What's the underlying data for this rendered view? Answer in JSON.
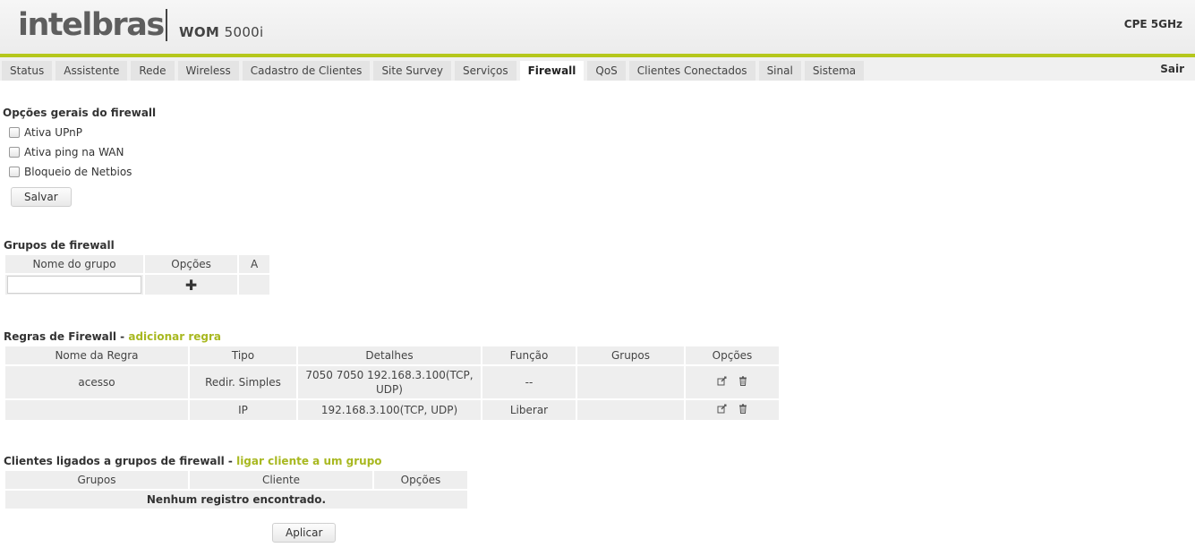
{
  "header": {
    "logo": "intelbras",
    "product_bold": "WOM",
    "product_suffix": "5000i",
    "device_type": "CPE 5GHz"
  },
  "nav": {
    "tabs": [
      "Status",
      "Assistente",
      "Rede",
      "Wireless",
      "Cadastro de Clientes",
      "Site Survey",
      "Serviços",
      "Firewall",
      "QoS",
      "Clientes Conectados",
      "Sinal",
      "Sistema"
    ],
    "active": "Firewall",
    "logout": "Sair"
  },
  "general": {
    "title": "Opções gerais do firewall",
    "options": [
      "Ativa UPnP",
      "Ativa ping na WAN",
      "Bloqueio de Netbios"
    ],
    "save_label": "Salvar"
  },
  "groups": {
    "title": "Grupos de firewall",
    "headers": [
      "Nome do grupo",
      "Opções",
      "A"
    ],
    "input_value": ""
  },
  "rules": {
    "title": "Regras de Firewall",
    "separator": " - ",
    "add_link": "adicionar regra",
    "headers": [
      "Nome da Regra",
      "Tipo",
      "Detalhes",
      "Função",
      "Grupos",
      "Opções"
    ],
    "rows": [
      {
        "name": "acesso",
        "type": "Redir. Simples",
        "details": "7050 7050 192.168.3.100(TCP, UDP)",
        "function": "--",
        "groups": ""
      },
      {
        "name": "",
        "type": "IP",
        "details": "192.168.3.100(TCP, UDP)",
        "function": "Liberar",
        "groups": ""
      }
    ]
  },
  "clients": {
    "title": "Clientes ligados a grupos de firewall",
    "separator": " - ",
    "link": "ligar cliente a um grupo",
    "headers": [
      "Grupos",
      "Cliente",
      "Opções"
    ],
    "empty_message": "Nenhum registro encontrado.",
    "apply_label": "Aplicar"
  },
  "colors": {
    "accent_green": "#b5c71c",
    "link_green": "#a8b820",
    "table_cell": "#eeeeee"
  },
  "icons": {
    "edit": "edit-icon",
    "delete": "trash-icon",
    "add": "plus-icon"
  }
}
